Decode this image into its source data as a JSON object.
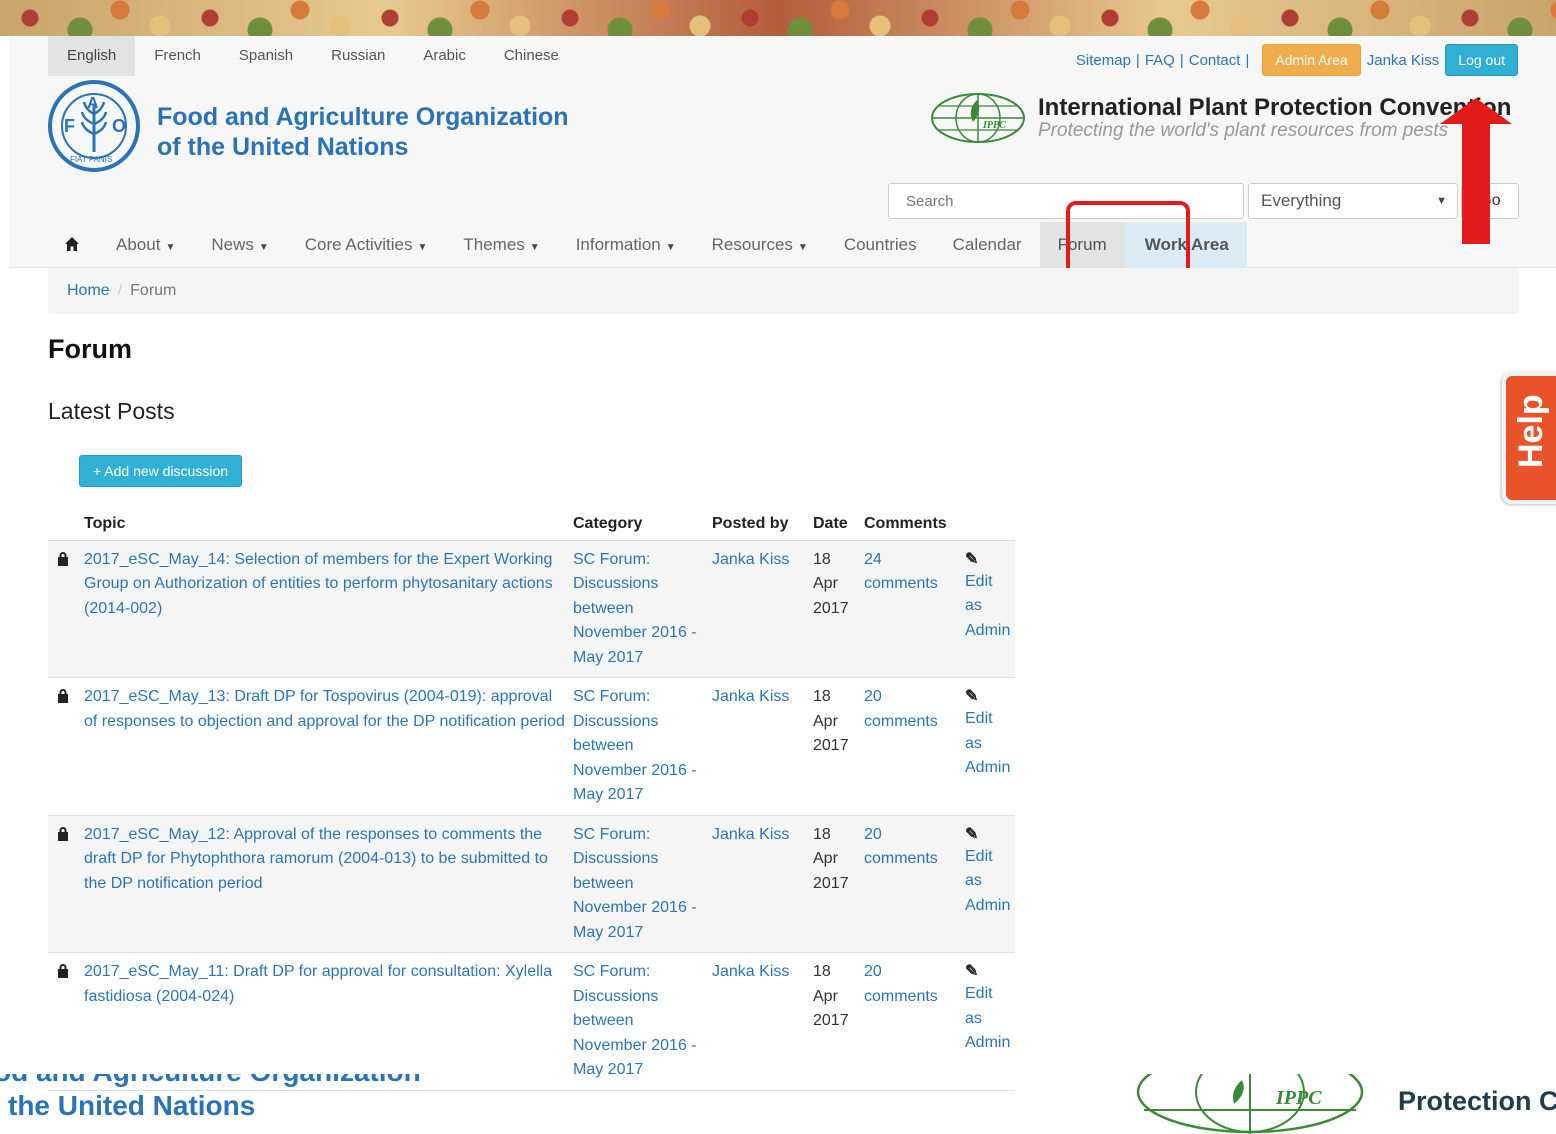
{
  "languages": [
    "English",
    "French",
    "Spanish",
    "Russian",
    "Arabic",
    "Chinese"
  ],
  "active_language": "English",
  "top_links": {
    "sitemap": "Sitemap",
    "faq": "FAQ",
    "contact": "Contact",
    "separator": "|",
    "admin_area": "Admin Area",
    "user": "Janka Kiss",
    "logout": "Log out"
  },
  "fao": {
    "logo_letters": [
      "F",
      "A",
      "O"
    ],
    "logo_motto": "FIAT PANIS",
    "name_line1": "Food and Agriculture Organization",
    "name_line2": "of the United Nations"
  },
  "ippc": {
    "logo_text": "IPPC",
    "title": "International Plant Protection Convention",
    "subtitle": "Protecting the world's plant resources from pests"
  },
  "search": {
    "placeholder": "Search",
    "scope": "Everything",
    "go_label": "Go"
  },
  "nav": {
    "items": [
      {
        "label": "About",
        "dropdown": true
      },
      {
        "label": "News",
        "dropdown": true
      },
      {
        "label": "Core Activities",
        "dropdown": true
      },
      {
        "label": "Themes",
        "dropdown": true
      },
      {
        "label": "Information",
        "dropdown": true
      },
      {
        "label": "Resources",
        "dropdown": true
      },
      {
        "label": "Countries",
        "dropdown": false
      },
      {
        "label": "Calendar",
        "dropdown": false
      },
      {
        "label": "Forum",
        "dropdown": false,
        "active": true
      },
      {
        "label": "Work Area",
        "dropdown": false
      }
    ]
  },
  "breadcrumb": {
    "home": "Home",
    "current": "Forum"
  },
  "page": {
    "title": "Forum",
    "section_title": "Latest Posts",
    "add_button": "+ Add new discussion"
  },
  "table": {
    "headers": {
      "topic": "Topic",
      "category": "Category",
      "posted_by": "Posted by",
      "date": "Date",
      "comments": "Comments"
    },
    "rows": [
      {
        "topic": "2017_eSC_May_14: Selection of members for the Expert Working Group on Authorization of entities to perform phytosanitary actions (2014-002)",
        "category": "SC Forum: Discussions between November 2016 - May 2017",
        "posted_by": "Janka Kiss",
        "date": "18 Apr 2017",
        "comments": "24 comments",
        "edit": "Edit as Admin"
      },
      {
        "topic": "2017_eSC_May_13: Draft DP for Tospovirus (2004-019): approval of responses to objection and approval for the DP notification period",
        "category": "SC Forum: Discussions between November 2016 - May 2017",
        "posted_by": "Janka Kiss",
        "date": "18 Apr 2017",
        "comments": "20 comments",
        "edit": "Edit as Admin"
      },
      {
        "topic": "2017_eSC_May_12: Approval of the responses to comments the draft DP for Phytophthora ramorum (2004-013) to be submitted to the DP notification period",
        "category": "SC Forum: Discussions between November 2016 - May 2017",
        "posted_by": "Janka Kiss",
        "date": "18 Apr 2017",
        "comments": "20 comments",
        "edit": "Edit as Admin"
      },
      {
        "topic": "2017_eSC_May_11: Draft DP for approval for consultation: Xylella fastidiosa (2004-024)",
        "category": "SC Forum: Discussions between November 2016 - May 2017",
        "posted_by": "Janka Kiss",
        "date": "18 Apr 2017",
        "comments": "20 comments",
        "edit": "Edit as Admin"
      }
    ]
  },
  "footer": {
    "fao_line1": "od and Agriculture Organization",
    "fao_line2": "the United Nations",
    "ippc_logo_text": "IPPC",
    "ippc_title": "Protection C"
  },
  "help_tab": "Help",
  "colors": {
    "link": "#2a76b6",
    "fao_blue": "#2a73b8",
    "admin_orange": "#f0ad4e",
    "info_blue": "#31b0d5",
    "annotation_red": "#e41b1b",
    "help_orange": "#e8532a"
  }
}
